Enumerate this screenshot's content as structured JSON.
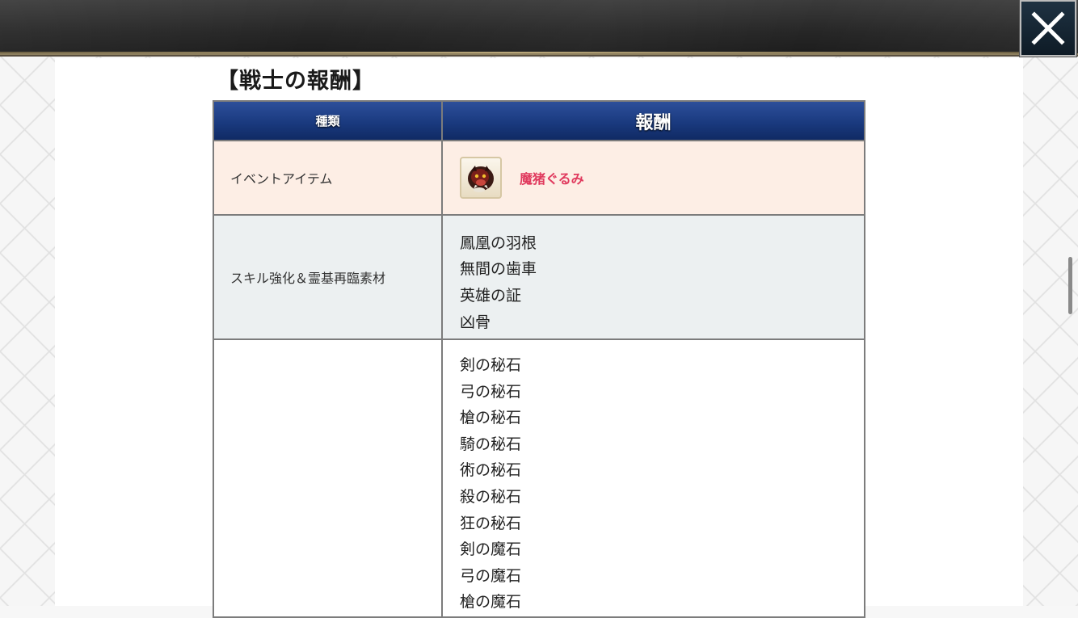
{
  "header": {
    "close_icon": "close-x-icon"
  },
  "section": {
    "title": "【戦士の報酬】"
  },
  "table": {
    "headers": {
      "type": "種類",
      "reward": "報酬"
    },
    "rows": [
      {
        "type": "イベントアイテム",
        "reward_item": "魔猪ぐるみ",
        "reward_icon": "boar-plush-icon"
      },
      {
        "type": "スキル強化＆霊基再臨素材",
        "rewards": [
          "鳳凰の羽根",
          "無間の歯車",
          "英雄の証",
          "凶骨"
        ]
      },
      {
        "type": "",
        "rewards": [
          "剣の秘石",
          "弓の秘石",
          "槍の秘石",
          "騎の秘石",
          "術の秘石",
          "殺の秘石",
          "狂の秘石",
          "剣の魔石",
          "弓の魔石",
          "槍の魔石"
        ]
      }
    ]
  },
  "colors": {
    "header_blue": "#1a3a7f",
    "event_row_bg": "#fdeee5",
    "skill_row_bg": "#ecf0f1",
    "item_name": "#e03a5e"
  }
}
